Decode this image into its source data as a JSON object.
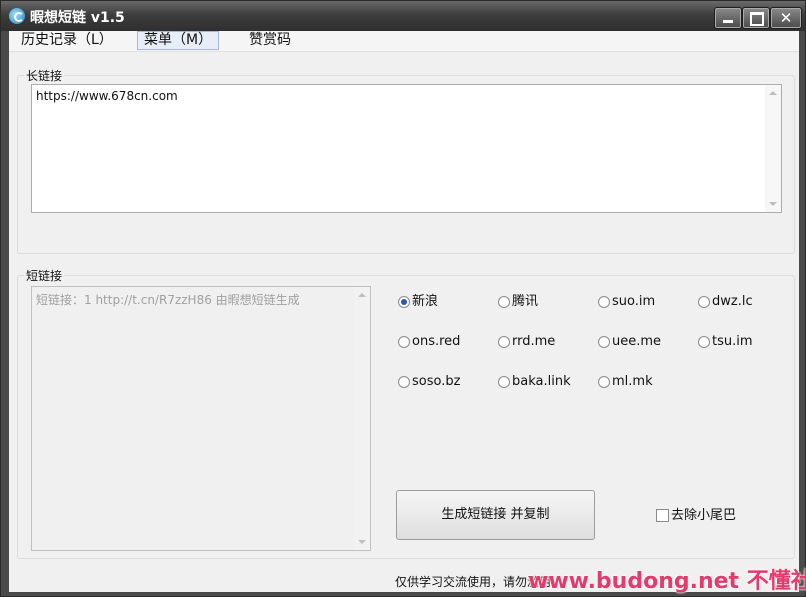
{
  "window": {
    "title": "暇想短链 v1.5"
  },
  "titlebar_buttons": {
    "minimize": "",
    "maximize": "",
    "close": "✕"
  },
  "menu": [
    "历史记录（L）",
    "菜单（M）",
    "赞赏码"
  ],
  "long_link": {
    "label": "长链接",
    "value": "https://www.678cn.com"
  },
  "short_link": {
    "label": "短链接",
    "value": "短链接：1    http://t.cn/R7zzH86   由暇想短链生成"
  },
  "services": [
    {
      "label": "新浪",
      "selected": true
    },
    {
      "label": "腾讯",
      "selected": false
    },
    {
      "label": "suo.im",
      "selected": false
    },
    {
      "label": "dwz.lc",
      "selected": false
    },
    {
      "label": "ons.red",
      "selected": false
    },
    {
      "label": "rrd.me",
      "selected": false
    },
    {
      "label": "uee.me",
      "selected": false
    },
    {
      "label": "tsu.im",
      "selected": false
    },
    {
      "label": "soso.bz",
      "selected": false
    },
    {
      "label": "baka.link",
      "selected": false
    },
    {
      "label": "ml.mk",
      "selected": false
    }
  ],
  "generate_button": "生成短链接 并复制",
  "remove_tail": {
    "label": "去除小尾巴",
    "checked": false
  },
  "footer": "仅供学习交流使用，请勿滥用",
  "watermark": "www.budong.net 不懂社区"
}
